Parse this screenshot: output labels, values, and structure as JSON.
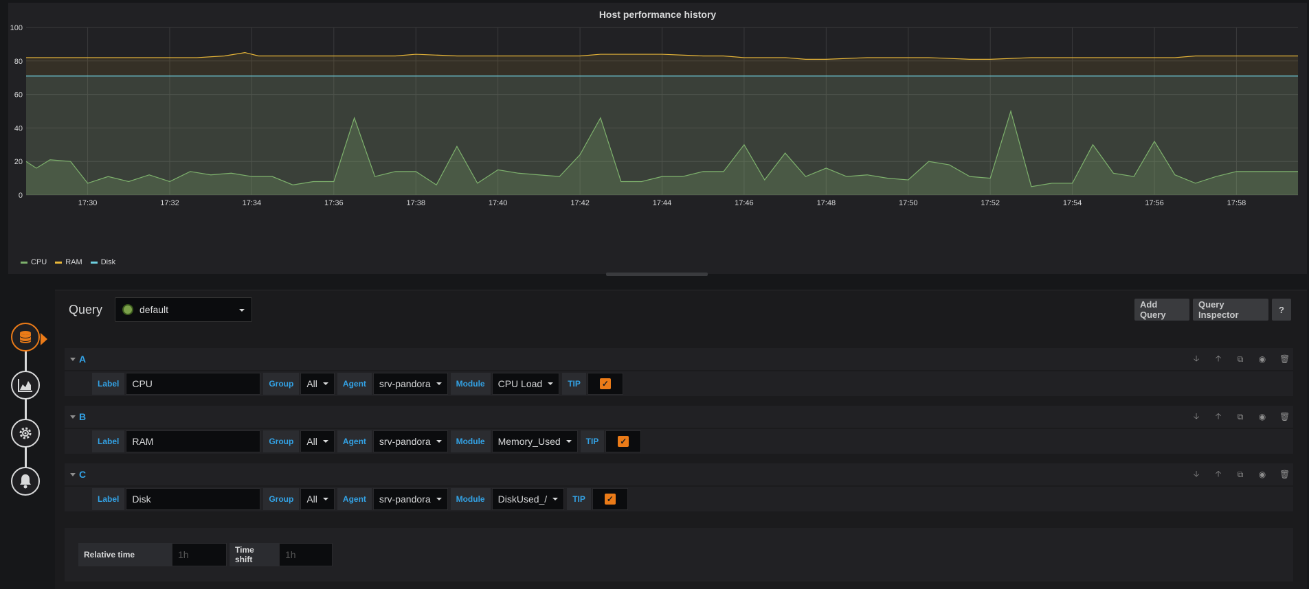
{
  "graph": {
    "title": "Host performance history",
    "legend": [
      {
        "name": "CPU",
        "color": "#7eb26d"
      },
      {
        "name": "RAM",
        "color": "#eab839"
      },
      {
        "name": "Disk",
        "color": "#6ed0e0"
      }
    ]
  },
  "chart_data": {
    "type": "line",
    "title": "Host performance history",
    "xlabel": "",
    "ylabel": "",
    "ylim": [
      0,
      100
    ],
    "yticks": [
      0,
      20,
      40,
      60,
      80,
      100
    ],
    "xticks": [
      "17:30",
      "17:32",
      "17:34",
      "17:36",
      "17:38",
      "17:40",
      "17:42",
      "17:44",
      "17:46",
      "17:48",
      "17:50",
      "17:52",
      "17:54",
      "17:56",
      "17:58"
    ],
    "xlim": [
      "17:28:30",
      "17:59:30"
    ],
    "grid": true,
    "legend_position": "bottom-left",
    "series": [
      {
        "name": "CPU",
        "color": "#7eb26d",
        "x": [
          "17:28:30",
          "17:28:45",
          "17:29:05",
          "17:29:35",
          "17:30:00",
          "17:30:30",
          "17:31:00",
          "17:31:30",
          "17:32:00",
          "17:32:30",
          "17:33:00",
          "17:33:30",
          "17:34:00",
          "17:34:30",
          "17:35:00",
          "17:35:30",
          "17:36:00",
          "17:36:30",
          "17:37:00",
          "17:37:30",
          "17:38:00",
          "17:38:30",
          "17:39:00",
          "17:39:30",
          "17:40:00",
          "17:40:30",
          "17:41:00",
          "17:41:30",
          "17:42:00",
          "17:42:30",
          "17:43:00",
          "17:43:30",
          "17:44:00",
          "17:44:30",
          "17:45:00",
          "17:45:30",
          "17:46:00",
          "17:46:30",
          "17:47:00",
          "17:47:30",
          "17:48:00",
          "17:48:30",
          "17:49:00",
          "17:49:30",
          "17:50:00",
          "17:50:30",
          "17:51:00",
          "17:51:30",
          "17:52:00",
          "17:52:30",
          "17:53:00",
          "17:53:30",
          "17:54:00",
          "17:54:30",
          "17:55:00",
          "17:55:30",
          "17:56:00",
          "17:56:30",
          "17:57:00",
          "17:57:30",
          "17:58:00",
          "17:58:30",
          "17:59:00",
          "17:59:30"
        ],
        "values": [
          20,
          16,
          21,
          20,
          7,
          11,
          8,
          12,
          8,
          14,
          12,
          13,
          11,
          11,
          6,
          8,
          8,
          46,
          11,
          14,
          14,
          6,
          29,
          7,
          15,
          13,
          12,
          11,
          24,
          46,
          8,
          8,
          11,
          11,
          14,
          14,
          30,
          9,
          25,
          11,
          16,
          11,
          12,
          10,
          9,
          20,
          18,
          11,
          10,
          50,
          5,
          7,
          7,
          30,
          13,
          11,
          32,
          12,
          7,
          11,
          14,
          14,
          14,
          14
        ]
      },
      {
        "name": "RAM",
        "color": "#eab839",
        "x": [
          "17:28:30",
          "17:30:00",
          "17:31:00",
          "17:32:00",
          "17:32:40",
          "17:33:20",
          "17:33:50",
          "17:34:10",
          "17:35:00",
          "17:36:00",
          "17:37:00",
          "17:37:30",
          "17:38:00",
          "17:39:00",
          "17:40:00",
          "17:41:00",
          "17:42:00",
          "17:42:30",
          "17:43:30",
          "17:44:00",
          "17:45:00",
          "17:45:30",
          "17:46:00",
          "17:47:00",
          "17:47:30",
          "17:48:00",
          "17:49:00",
          "17:50:00",
          "17:50:30",
          "17:51:30",
          "17:52:00",
          "17:53:00",
          "17:54:00",
          "17:55:00",
          "17:56:00",
          "17:56:30",
          "17:57:00",
          "17:58:00",
          "17:59:30"
        ],
        "values": [
          82,
          82,
          82,
          82,
          82,
          83,
          85,
          83,
          83,
          83,
          83,
          83,
          84,
          83,
          83,
          83,
          83,
          84,
          84,
          84,
          83,
          83,
          82,
          82,
          81,
          81,
          82,
          82,
          82,
          81,
          81,
          82,
          82,
          82,
          82,
          82,
          83,
          83,
          83
        ]
      },
      {
        "name": "Disk",
        "color": "#6ed0e0",
        "x": [
          "17:28:30",
          "17:59:30"
        ],
        "values": [
          71,
          71
        ]
      }
    ]
  },
  "editor": {
    "query_title": "Query",
    "datasource": "default",
    "add_query": "Add Query",
    "query_inspector": "Query Inspector",
    "help": "?"
  },
  "queries": [
    {
      "ref": "A",
      "label_tag": "Label",
      "label_value": "CPU",
      "group_tag": "Group",
      "group_value": "All",
      "agent_tag": "Agent",
      "agent_value": "srv-pandora",
      "module_tag": "Module",
      "module_value": "CPU Load",
      "tip_tag": "TIP"
    },
    {
      "ref": "B",
      "label_tag": "Label",
      "label_value": "RAM",
      "group_tag": "Group",
      "group_value": "All",
      "agent_tag": "Agent",
      "agent_value": "srv-pandora",
      "module_tag": "Module",
      "module_value": "Memory_Used",
      "tip_tag": "TIP"
    },
    {
      "ref": "C",
      "label_tag": "Label",
      "label_value": "Disk",
      "group_tag": "Group",
      "group_value": "All",
      "agent_tag": "Agent",
      "agent_value": "srv-pandora",
      "module_tag": "Module",
      "module_value": "DiskUsed_/",
      "tip_tag": "TIP"
    }
  ],
  "time_options": {
    "relative_label": "Relative time",
    "relative_placeholder": "1h",
    "shift_label": "Time shift",
    "shift_placeholder": "1h"
  },
  "nav": {
    "items": [
      {
        "icon": "database-icon",
        "active": true
      },
      {
        "icon": "graph-icon",
        "active": false
      },
      {
        "icon": "gear-icon",
        "active": false
      },
      {
        "icon": "bell-icon",
        "active": false
      }
    ]
  },
  "colors": {
    "accent": "#eb7b18",
    "link_blue": "#33a2e5",
    "panel_bg": "#212124",
    "page_bg": "#161719"
  }
}
